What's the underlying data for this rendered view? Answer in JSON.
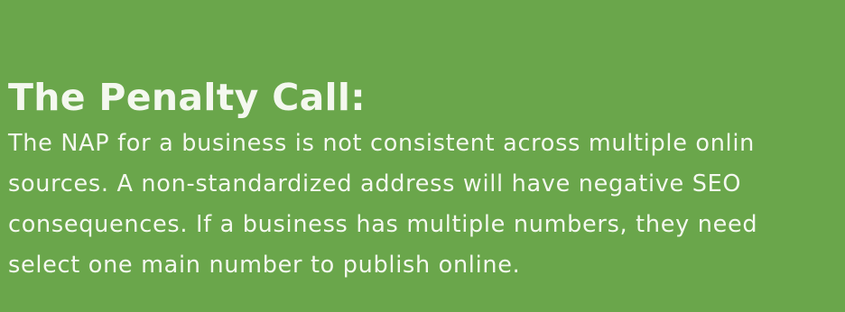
{
  "panel": {
    "background_color": "#6aa64b",
    "text_color": "#f4f8ef",
    "title": "The Penalty Call:",
    "body_lines": [
      "The NAP for a business is not consistent across multiple onlin",
      "sources. A non-standardized address will have negative SEO",
      "consequences. If a business has multiple numbers, they need",
      "select one main number to publish online."
    ]
  }
}
